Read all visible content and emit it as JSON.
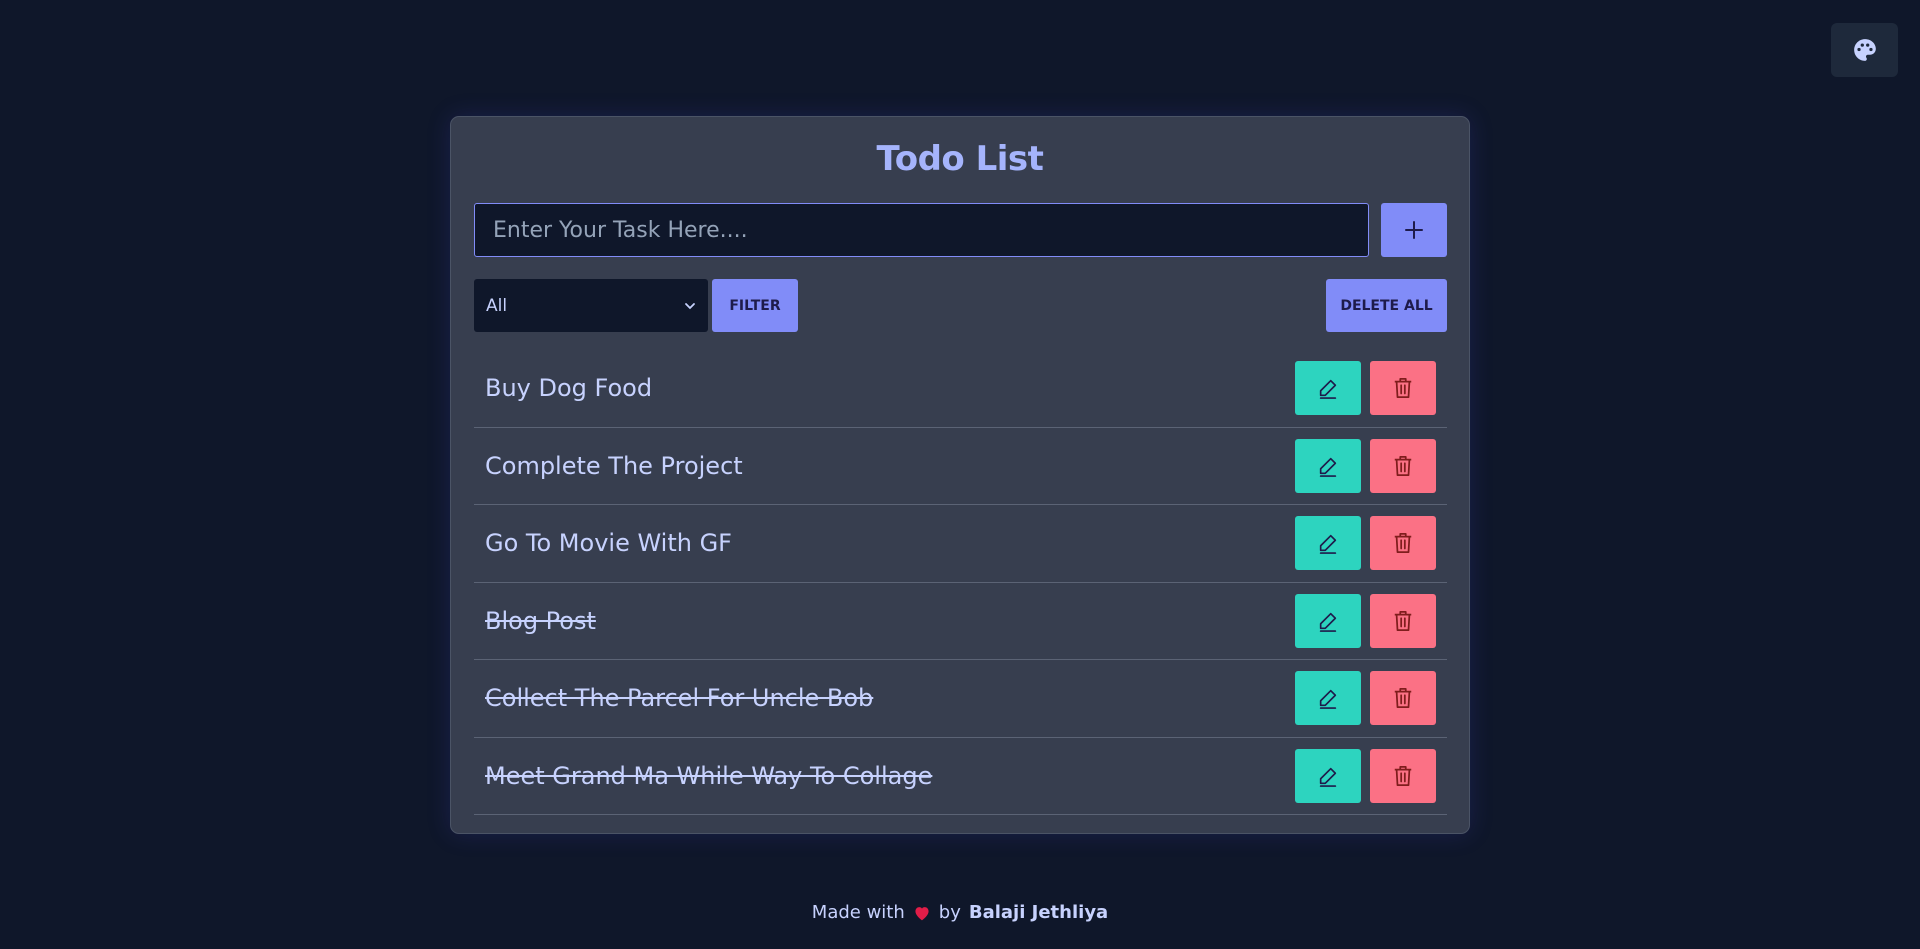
{
  "app": {
    "title": "Todo List"
  },
  "theme_toggle": {
    "icon": "palette-icon"
  },
  "input": {
    "placeholder": "Enter Your Task Here....",
    "value": ""
  },
  "add_button": {
    "label": "+"
  },
  "filter": {
    "selected": "All",
    "button_label": "FILTER"
  },
  "delete_all": {
    "label": "DELETE ALL"
  },
  "todos": [
    {
      "text": "Buy Dog Food",
      "completed": false
    },
    {
      "text": "Complete The Project",
      "completed": false
    },
    {
      "text": "Go To Movie With GF",
      "completed": false
    },
    {
      "text": "Blog Post",
      "completed": true
    },
    {
      "text": "Collect The Parcel For Uncle Bob",
      "completed": true
    },
    {
      "text": "Meet Grand Ma While Way To Collage",
      "completed": true
    }
  ],
  "footer": {
    "prefix": "Made with",
    "by": "by",
    "author": "Balaji Jethliya",
    "heart_color": "#e11d48"
  },
  "colors": {
    "background": "#0f172a",
    "card": "#373e4f",
    "accent": "#818cf8",
    "edit": "#2dd4bf",
    "delete": "#fb7185"
  }
}
